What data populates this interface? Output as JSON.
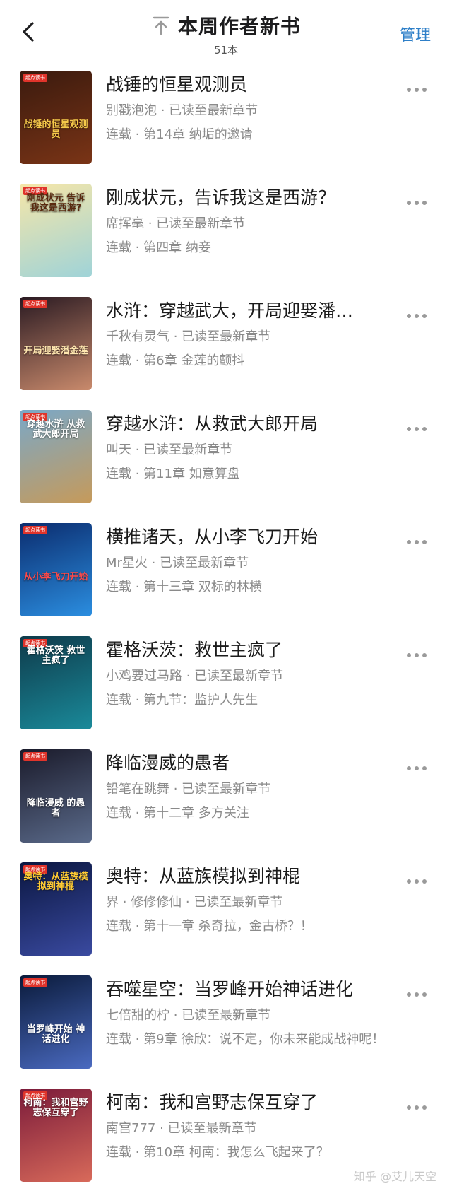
{
  "header": {
    "title": "本周作者新书",
    "count": "51本",
    "manage_label": "管理"
  },
  "books": [
    {
      "title": "战锤的恒星观测员",
      "meta": "别戳泡泡 · 已读至最新章节",
      "chapter": "连载 · 第14章 纳垢的邀请",
      "cover_text": "战锤的恒星观测员",
      "cover_colors": [
        "#3a1a0e",
        "#7a3416"
      ],
      "cover_text_color": "#f5c94a"
    },
    {
      "title": "刚成状元，告诉我这是西游？",
      "meta": "席挥毫 · 已读至最新章节",
      "chapter": "连载 · 第四章 纳妾",
      "cover_text": "刚成状元 告诉我这是西游?",
      "cover_colors": [
        "#f6e6a8",
        "#9fd3d8"
      ],
      "cover_text_color": "#5a2a10"
    },
    {
      "title": "水浒：穿越武大，开局迎娶潘…",
      "meta": "千秋有灵气 · 已读至最新章节",
      "chapter": "连载 · 第6章 金莲的颤抖",
      "cover_text": "开局迎娶潘金莲",
      "cover_colors": [
        "#2a1a22",
        "#c98a6c"
      ],
      "cover_text_color": "#ffe7b0"
    },
    {
      "title": "穿越水浒：从救武大郎开局",
      "meta": "叫天 · 已读至最新章节",
      "chapter": "连载 · 第11章 如意算盘",
      "cover_text": "穿越水浒 从救武大郎开局",
      "cover_colors": [
        "#7aa8c8",
        "#c69a5a"
      ],
      "cover_text_color": "#ffffff"
    },
    {
      "title": "横推诸天，从小李飞刀开始",
      "meta": "Mr星火 · 已读至最新章节",
      "chapter": "连载 · 第十三章 双标的林横",
      "cover_text": "从小李飞刀开始",
      "cover_colors": [
        "#0b2c6e",
        "#2b8ee0"
      ],
      "cover_text_color": "#ff4a4a"
    },
    {
      "title": "霍格沃茨：救世主疯了",
      "meta": "小鸡要过马路 · 已读至最新章节",
      "chapter": "连载 · 第九节：监护人先生",
      "cover_text": "霍格沃茨 救世主疯了",
      "cover_colors": [
        "#0e3a4a",
        "#1a8a9a"
      ],
      "cover_text_color": "#ffffff"
    },
    {
      "title": "降临漫威的愚者",
      "meta": "铅笔在跳舞 · 已读至最新章节",
      "chapter": "连载 · 第十二章 多方关注",
      "cover_text": "降临漫威 的愚者",
      "cover_colors": [
        "#1a1a2a",
        "#5a6a8a"
      ],
      "cover_text_color": "#ffffff"
    },
    {
      "title": "奥特：从蓝族模拟到神棍",
      "meta": "界 · 修修修仙 · 已读至最新章节",
      "chapter": "连载 · 第十一章 杀奇拉，金古桥？！",
      "cover_text": "奥特：从蓝族模拟到神棍",
      "cover_colors": [
        "#0a1640",
        "#3a4aa0"
      ],
      "cover_text_color": "#ffcc33"
    },
    {
      "title": "吞噬星空：当罗峰开始神话进化",
      "meta": "七倍甜的柠 · 已读至最新章节",
      "chapter": "连载 · 第9章 徐欣：说不定，你未来能成战神呢！",
      "cover_text": "当罗峰开始 神话进化",
      "cover_colors": [
        "#0a1a3a",
        "#4a6ac0"
      ],
      "cover_text_color": "#ffffff"
    },
    {
      "title": "柯南：我和宫野志保互穿了",
      "meta": "南宫777 · 已读至最新章节",
      "chapter": "连载 · 第10章 柯南：我怎么飞起来了？",
      "cover_text": "柯南：我和宫野 志保互穿了",
      "cover_colors": [
        "#7a1a3a",
        "#d86a5a"
      ],
      "cover_text_color": "#ffffff"
    }
  ],
  "cover_badge": "起点读书",
  "watermark": "知乎 @艾儿天空",
  "colors": {
    "accent": "#2e7fc8",
    "meta_text": "#8a8a8a"
  }
}
